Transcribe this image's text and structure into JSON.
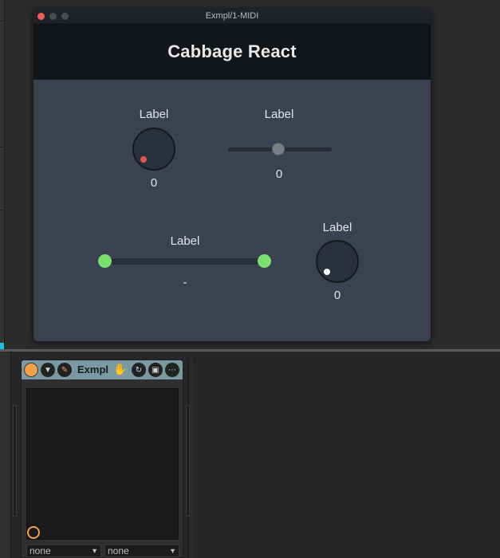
{
  "window": {
    "title": "Exmpl/1-MIDI",
    "header_title": "Cabbage React"
  },
  "controls": {
    "knob1": {
      "label": "Label",
      "value": "0",
      "dot_color": "#e05555"
    },
    "hslider": {
      "label": "Label",
      "value": "0"
    },
    "range": {
      "label": "Label",
      "value": "-",
      "thumb_color": "#7ae06d"
    },
    "knob2": {
      "label": "Label",
      "value": "0",
      "dot_color": "#ffffff"
    }
  },
  "device": {
    "name": "Exmpl",
    "header_color": "#7a9aa3",
    "icons": [
      "power-icon",
      "fold-icon",
      "wrench-icon",
      "hand-icon",
      "refresh-icon",
      "save-icon",
      "more-icon"
    ],
    "select_left": "none",
    "select_right": "none"
  },
  "colors": {
    "panel_bg": "#3a4150",
    "header_bg": "#121518",
    "accent_orange": "#f3a14c",
    "marker_cyan": "#19c3e0"
  }
}
